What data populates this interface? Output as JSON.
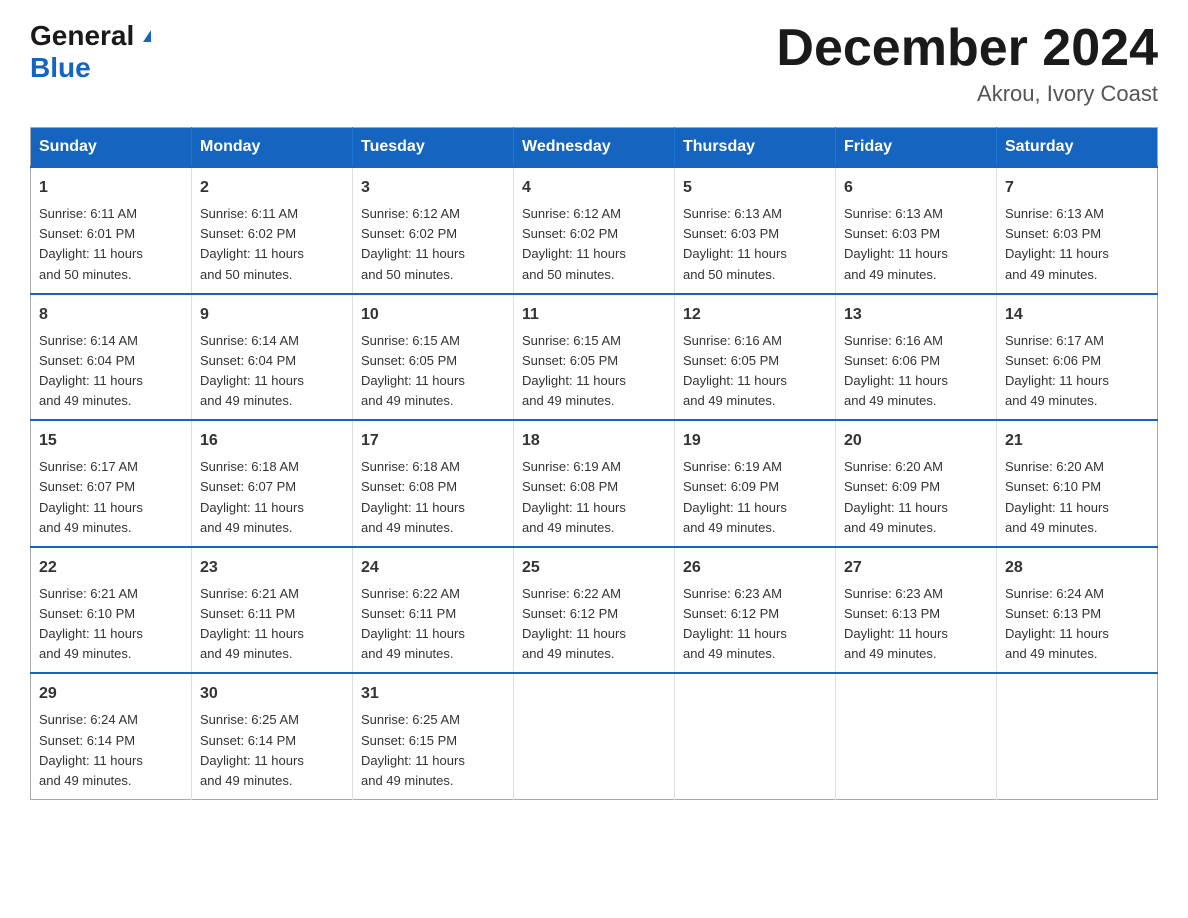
{
  "logo": {
    "general": "General",
    "blue": "Blue",
    "triangle": "▲"
  },
  "title": {
    "month": "December 2024",
    "location": "Akrou, Ivory Coast"
  },
  "header": {
    "days": [
      "Sunday",
      "Monday",
      "Tuesday",
      "Wednesday",
      "Thursday",
      "Friday",
      "Saturday"
    ]
  },
  "weeks": [
    [
      {
        "day": "1",
        "sunrise": "6:11 AM",
        "sunset": "6:01 PM",
        "daylight": "11 hours and 50 minutes."
      },
      {
        "day": "2",
        "sunrise": "6:11 AM",
        "sunset": "6:02 PM",
        "daylight": "11 hours and 50 minutes."
      },
      {
        "day": "3",
        "sunrise": "6:12 AM",
        "sunset": "6:02 PM",
        "daylight": "11 hours and 50 minutes."
      },
      {
        "day": "4",
        "sunrise": "6:12 AM",
        "sunset": "6:02 PM",
        "daylight": "11 hours and 50 minutes."
      },
      {
        "day": "5",
        "sunrise": "6:13 AM",
        "sunset": "6:03 PM",
        "daylight": "11 hours and 50 minutes."
      },
      {
        "day": "6",
        "sunrise": "6:13 AM",
        "sunset": "6:03 PM",
        "daylight": "11 hours and 49 minutes."
      },
      {
        "day": "7",
        "sunrise": "6:13 AM",
        "sunset": "6:03 PM",
        "daylight": "11 hours and 49 minutes."
      }
    ],
    [
      {
        "day": "8",
        "sunrise": "6:14 AM",
        "sunset": "6:04 PM",
        "daylight": "11 hours and 49 minutes."
      },
      {
        "day": "9",
        "sunrise": "6:14 AM",
        "sunset": "6:04 PM",
        "daylight": "11 hours and 49 minutes."
      },
      {
        "day": "10",
        "sunrise": "6:15 AM",
        "sunset": "6:05 PM",
        "daylight": "11 hours and 49 minutes."
      },
      {
        "day": "11",
        "sunrise": "6:15 AM",
        "sunset": "6:05 PM",
        "daylight": "11 hours and 49 minutes."
      },
      {
        "day": "12",
        "sunrise": "6:16 AM",
        "sunset": "6:05 PM",
        "daylight": "11 hours and 49 minutes."
      },
      {
        "day": "13",
        "sunrise": "6:16 AM",
        "sunset": "6:06 PM",
        "daylight": "11 hours and 49 minutes."
      },
      {
        "day": "14",
        "sunrise": "6:17 AM",
        "sunset": "6:06 PM",
        "daylight": "11 hours and 49 minutes."
      }
    ],
    [
      {
        "day": "15",
        "sunrise": "6:17 AM",
        "sunset": "6:07 PM",
        "daylight": "11 hours and 49 minutes."
      },
      {
        "day": "16",
        "sunrise": "6:18 AM",
        "sunset": "6:07 PM",
        "daylight": "11 hours and 49 minutes."
      },
      {
        "day": "17",
        "sunrise": "6:18 AM",
        "sunset": "6:08 PM",
        "daylight": "11 hours and 49 minutes."
      },
      {
        "day": "18",
        "sunrise": "6:19 AM",
        "sunset": "6:08 PM",
        "daylight": "11 hours and 49 minutes."
      },
      {
        "day": "19",
        "sunrise": "6:19 AM",
        "sunset": "6:09 PM",
        "daylight": "11 hours and 49 minutes."
      },
      {
        "day": "20",
        "sunrise": "6:20 AM",
        "sunset": "6:09 PM",
        "daylight": "11 hours and 49 minutes."
      },
      {
        "day": "21",
        "sunrise": "6:20 AM",
        "sunset": "6:10 PM",
        "daylight": "11 hours and 49 minutes."
      }
    ],
    [
      {
        "day": "22",
        "sunrise": "6:21 AM",
        "sunset": "6:10 PM",
        "daylight": "11 hours and 49 minutes."
      },
      {
        "day": "23",
        "sunrise": "6:21 AM",
        "sunset": "6:11 PM",
        "daylight": "11 hours and 49 minutes."
      },
      {
        "day": "24",
        "sunrise": "6:22 AM",
        "sunset": "6:11 PM",
        "daylight": "11 hours and 49 minutes."
      },
      {
        "day": "25",
        "sunrise": "6:22 AM",
        "sunset": "6:12 PM",
        "daylight": "11 hours and 49 minutes."
      },
      {
        "day": "26",
        "sunrise": "6:23 AM",
        "sunset": "6:12 PM",
        "daylight": "11 hours and 49 minutes."
      },
      {
        "day": "27",
        "sunrise": "6:23 AM",
        "sunset": "6:13 PM",
        "daylight": "11 hours and 49 minutes."
      },
      {
        "day": "28",
        "sunrise": "6:24 AM",
        "sunset": "6:13 PM",
        "daylight": "11 hours and 49 minutes."
      }
    ],
    [
      {
        "day": "29",
        "sunrise": "6:24 AM",
        "sunset": "6:14 PM",
        "daylight": "11 hours and 49 minutes."
      },
      {
        "day": "30",
        "sunrise": "6:25 AM",
        "sunset": "6:14 PM",
        "daylight": "11 hours and 49 minutes."
      },
      {
        "day": "31",
        "sunrise": "6:25 AM",
        "sunset": "6:15 PM",
        "daylight": "11 hours and 49 minutes."
      },
      null,
      null,
      null,
      null
    ]
  ],
  "labels": {
    "sunrise": "Sunrise: ",
    "sunset": "Sunset: ",
    "daylight": "Daylight: "
  }
}
